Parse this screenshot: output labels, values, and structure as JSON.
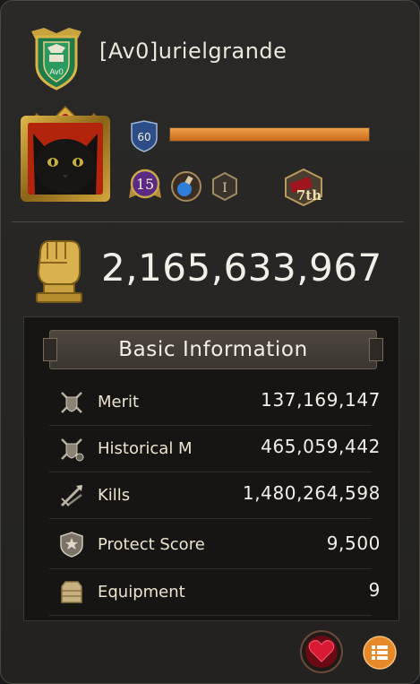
{
  "profile": {
    "alliance_tag": "[Av0]",
    "player_name": "[Av0]urielgrande",
    "badge_text": "Av0",
    "level": "60",
    "xp_fraction": 1.0,
    "rank_badge_value": "15",
    "tier_badge_value": "I",
    "ranking_badge_value": "7th"
  },
  "power": {
    "value": "2,165,633,967"
  },
  "basic_info": {
    "title": "Basic Information",
    "rows": [
      {
        "label": "Merit",
        "value": "137,169,147",
        "icon": "crossed-swords-shield-icon"
      },
      {
        "label": "Historical M",
        "value": "465,059,442",
        "icon": "crossed-swords-shield-icon"
      },
      {
        "label": "Kills",
        "value": "1,480,264,598",
        "icon": "kills-swords-icon"
      },
      {
        "label": "Protect Score",
        "value": "9,500",
        "icon": "protect-shield-icon"
      },
      {
        "label": "Equipment",
        "value": "9",
        "icon": "armor-icon"
      }
    ]
  },
  "colors": {
    "xp_bar": "#e08a2c",
    "avatar_bg": "#b2240c",
    "like_button": "#b3102a",
    "menu_button": "#e88a2a"
  }
}
